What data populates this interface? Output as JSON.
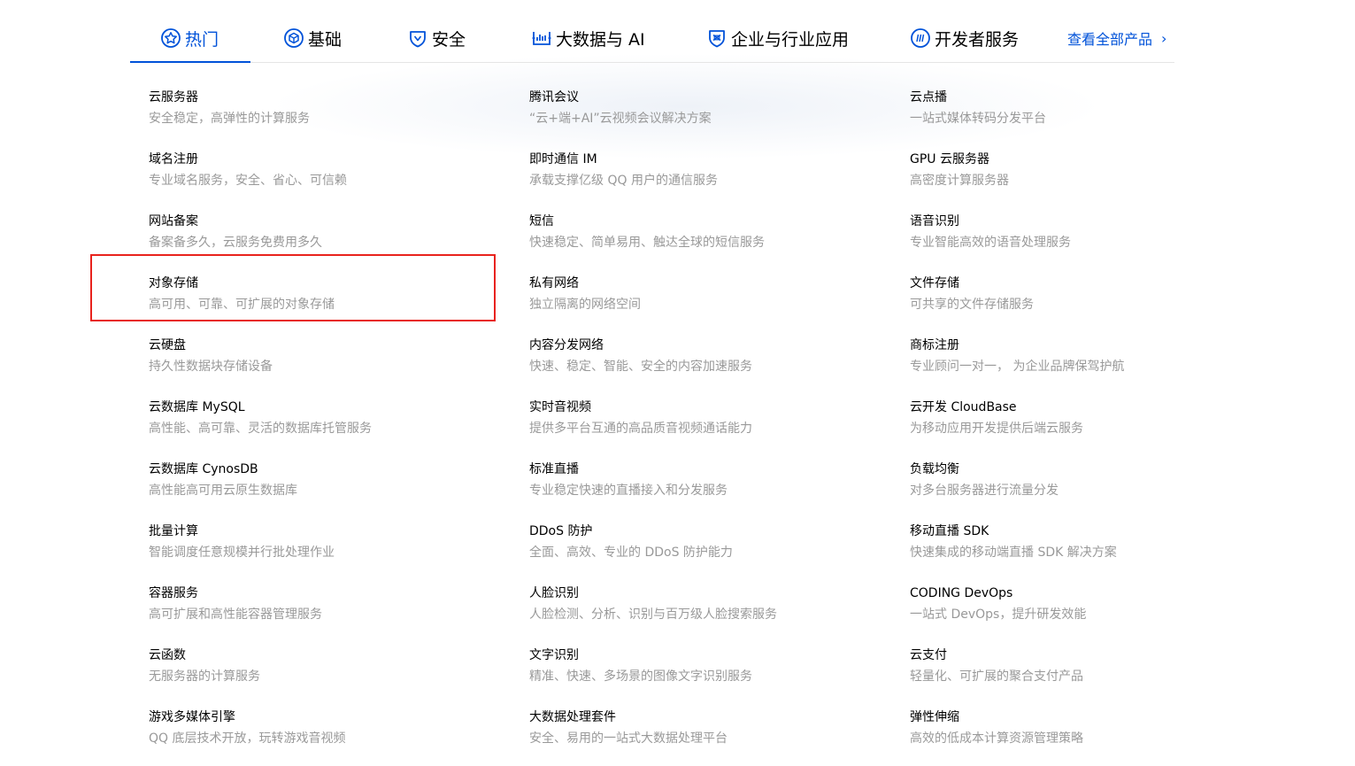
{
  "colors": {
    "accent": "#0052d9",
    "text": "#000000",
    "muted": "#999999",
    "highlight": "#e8231d"
  },
  "tabs": [
    {
      "label": "热门",
      "icon": "star-badge-icon",
      "active": true
    },
    {
      "label": "基础",
      "icon": "base-cube-icon",
      "active": false
    },
    {
      "label": "安全",
      "icon": "shield-icon",
      "active": false
    },
    {
      "label": "大数据与 AI",
      "icon": "bigdata-chart-icon",
      "active": false
    },
    {
      "label": "企业与行业应用",
      "icon": "enterprise-shield-icon",
      "active": false
    },
    {
      "label": "开发者服务",
      "icon": "developer-code-icon",
      "active": false
    }
  ],
  "view_all": {
    "label": "查看全部产品",
    "icon": "chevron-right-icon"
  },
  "products": {
    "column1": [
      {
        "name": "云服务器",
        "desc": "安全稳定，高弹性的计算服务"
      },
      {
        "name": "域名注册",
        "desc": "专业域名服务，安全、省心、可信赖"
      },
      {
        "name": "网站备案",
        "desc": "备案备多久，云服务免费用多久"
      },
      {
        "name": "对象存储",
        "desc": "高可用、可靠、可扩展的对象存储"
      },
      {
        "name": "云硬盘",
        "desc": "持久性数据块存储设备"
      },
      {
        "name": "云数据库 MySQL",
        "desc": "高性能、高可靠、灵活的数据库托管服务"
      },
      {
        "name": "云数据库 CynosDB",
        "desc": "高性能高可用云原生数据库"
      },
      {
        "name": "批量计算",
        "desc": "智能调度任意规模并行批处理作业"
      },
      {
        "name": "容器服务",
        "desc": "高可扩展和高性能容器管理服务"
      },
      {
        "name": "云函数",
        "desc": "无服务器的计算服务"
      },
      {
        "name": "游戏多媒体引擎",
        "desc": "QQ 底层技术开放，玩转游戏音视频"
      }
    ],
    "column2": [
      {
        "name": "腾讯会议",
        "desc": "“云+端+AI”云视频会议解决方案"
      },
      {
        "name": "即时通信 IM",
        "desc": "承载支撑亿级 QQ 用户的通信服务"
      },
      {
        "name": "短信",
        "desc": "快速稳定、简单易用、触达全球的短信服务"
      },
      {
        "name": "私有网络",
        "desc": "独立隔离的网络空间"
      },
      {
        "name": "内容分发网络",
        "desc": "快速、稳定、智能、安全的内容加速服务"
      },
      {
        "name": "实时音视频",
        "desc": "提供多平台互通的高品质音视频通话能力"
      },
      {
        "name": "标准直播",
        "desc": "专业稳定快速的直播接入和分发服务"
      },
      {
        "name": "DDoS 防护",
        "desc": "全面、高效、专业的 DDoS 防护能力"
      },
      {
        "name": "人脸识别",
        "desc": "人脸检测、分析、识别与百万级人脸搜索服务"
      },
      {
        "name": "文字识别",
        "desc": "精准、快速、多场景的图像文字识别服务"
      },
      {
        "name": "大数据处理套件",
        "desc": "安全、易用的一站式大数据处理平台"
      }
    ],
    "column3": [
      {
        "name": "云点播",
        "desc": "一站式媒体转码分发平台"
      },
      {
        "name": "GPU 云服务器",
        "desc": "高密度计算服务器"
      },
      {
        "name": "语音识别",
        "desc": "专业智能高效的语音处理服务"
      },
      {
        "name": "文件存储",
        "desc": "可共享的文件存储服务"
      },
      {
        "name": "商标注册",
        "desc": "专业顾问一对一， 为企业品牌保驾护航"
      },
      {
        "name": "云开发 CloudBase",
        "desc": "为移动应用开发提供后端云服务"
      },
      {
        "name": "负载均衡",
        "desc": "对多台服务器进行流量分发"
      },
      {
        "name": "移动直播 SDK",
        "desc": "快速集成的移动端直播 SDK 解决方案"
      },
      {
        "name": "CODING DevOps",
        "desc": "一站式 DevOps，提升研发效能"
      },
      {
        "name": "云支付",
        "desc": "轻量化、可扩展的聚合支付产品"
      },
      {
        "name": "弹性伸缩",
        "desc": "高效的低成本计算资源管理策略"
      }
    ]
  }
}
